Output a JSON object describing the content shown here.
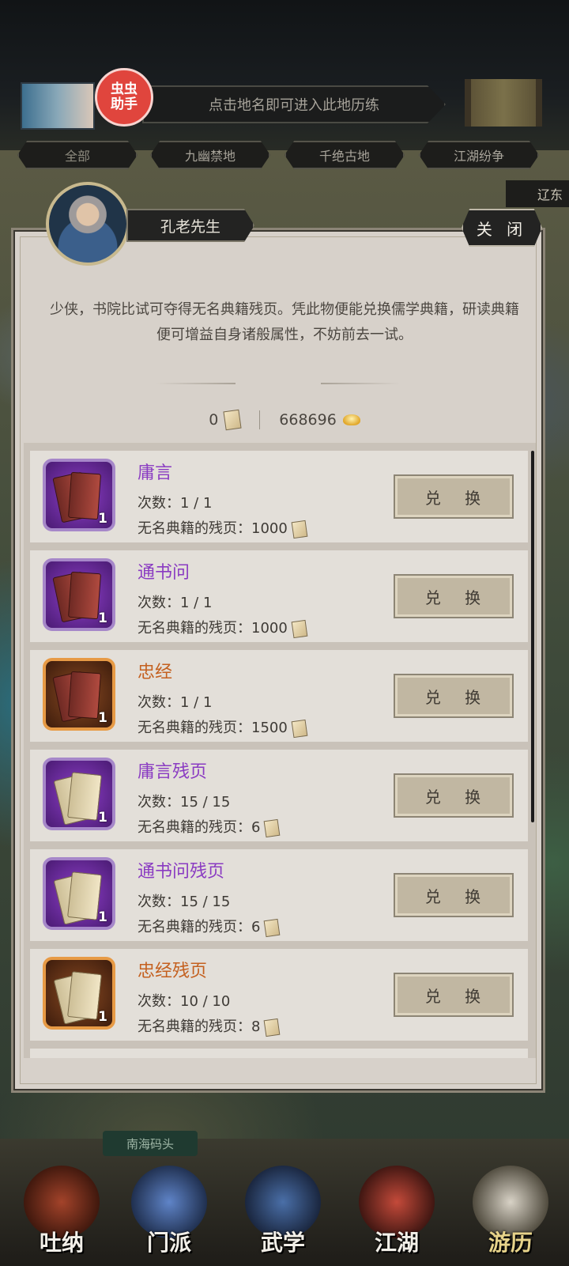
{
  "header": {
    "helper_badge": "虫虫\n助手",
    "search_hint": "点击地名即可进入此地历练"
  },
  "region_tabs": [
    {
      "label": "全部"
    },
    {
      "label": "九幽禁地"
    },
    {
      "label": "千绝古地"
    },
    {
      "label": "江湖纷争"
    }
  ],
  "side_label": "辽东",
  "dialog": {
    "npc_name": "孔老先生",
    "close_label": "关 闭",
    "description": "少侠，书院比试可夺得无名典籍残页。凭此物便能兑换儒学典籍，研读典籍便可增益自身诸般属性，不妨前去一试。",
    "pages_owned": "0",
    "gold_owned": "668696"
  },
  "items": [
    {
      "title": "庸言",
      "count": "次数：1 / 1",
      "cost": "无名典籍的残页：1000",
      "quantity": "1",
      "rarity": "purple",
      "kind": "book"
    },
    {
      "title": "通书问",
      "count": "次数：1 / 1",
      "cost": "无名典籍的残页：1000",
      "quantity": "1",
      "rarity": "purple",
      "kind": "book"
    },
    {
      "title": "忠经",
      "count": "次数：1 / 1",
      "cost": "无名典籍的残页：1500",
      "quantity": "1",
      "rarity": "orange",
      "kind": "book"
    },
    {
      "title": "庸言残页",
      "count": "次数：15 / 15",
      "cost": "无名典籍的残页：6",
      "quantity": "1",
      "rarity": "purple",
      "kind": "paper"
    },
    {
      "title": "通书问残页",
      "count": "次数：15 / 15",
      "cost": "无名典籍的残页：6",
      "quantity": "1",
      "rarity": "purple",
      "kind": "paper"
    },
    {
      "title": "忠经残页",
      "count": "次数：10 / 10",
      "cost": "无名典籍的残页：8",
      "quantity": "1",
      "rarity": "orange",
      "kind": "paper"
    }
  ],
  "exchange_label": "兑 换",
  "location_label": "南海码头",
  "nav": [
    {
      "label": "吐纳"
    },
    {
      "label": "门派"
    },
    {
      "label": "武学"
    },
    {
      "label": "江湖"
    },
    {
      "label": "游历"
    }
  ]
}
